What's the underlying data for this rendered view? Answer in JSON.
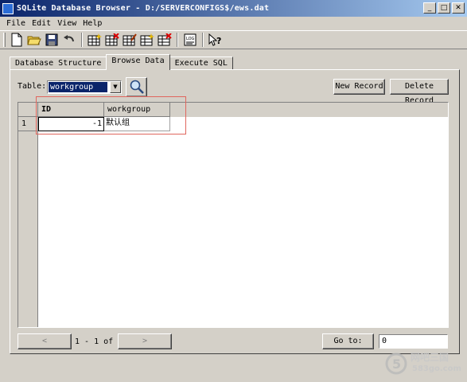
{
  "window": {
    "title": "SQLite Database Browser - D:/SERVERCONFIGS$/ews.dat"
  },
  "menu": [
    "File",
    "Edit",
    "View",
    "Help"
  ],
  "toolbar": [
    "new-file-icon",
    "open-folder-icon",
    "save-icon",
    "undo-icon",
    "create-table-icon",
    "delete-table-icon",
    "modify-table-icon",
    "create-index-icon",
    "delete-index-icon",
    "log-icon",
    "whats-this-icon"
  ],
  "tabs": [
    "Database Structure",
    "Browse Data",
    "Execute SQL"
  ],
  "browse": {
    "table_label": "Table:",
    "table_selected": "workgroup",
    "new_record": "New Record",
    "delete_record": "Delete Record"
  },
  "grid": {
    "columns": [
      "ID",
      "workgroup"
    ],
    "rows": [
      {
        "index": "1",
        "id": "-1",
        "workgroup": "默认组"
      }
    ]
  },
  "pager": {
    "range": "1 - 1 of 1",
    "goto_label": "Go to:",
    "goto_value": "0"
  },
  "watermark": {
    "cn": "网吧三国",
    "url": "583go.com"
  }
}
